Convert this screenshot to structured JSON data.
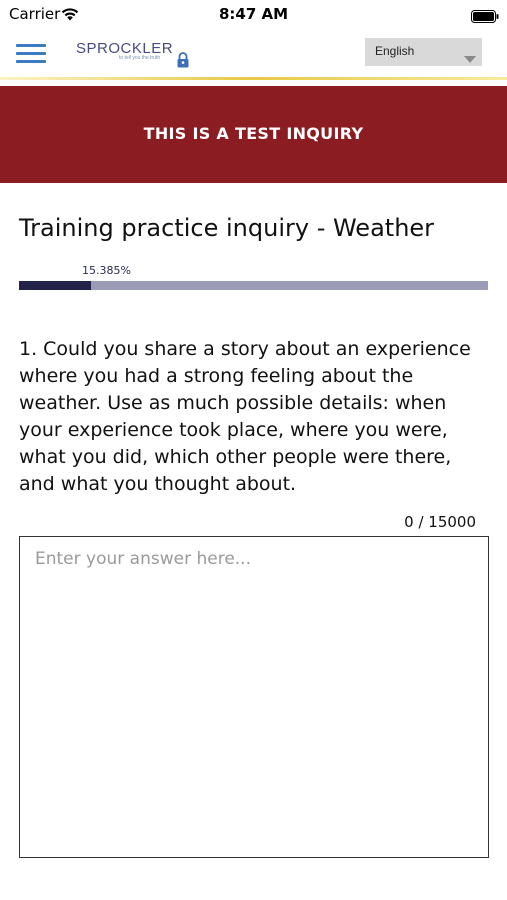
{
  "status_bar": {
    "carrier": "Carrier",
    "time": "8:47 AM",
    "wifi_icon": "wifi-icon",
    "battery_icon": "battery-icon"
  },
  "header": {
    "menu_icon": "hamburger-menu-icon",
    "logo_text": "SPROCKLER",
    "logo_tagline": "to tell you the truth",
    "lock_icon": "lock-icon",
    "language": {
      "selected": "English",
      "caret_icon": "chevron-down-icon"
    },
    "accent_line_color": "#e8c845"
  },
  "banner": {
    "text": "THIS IS A TEST INQUIRY",
    "color": "#8b1c22"
  },
  "inquiry": {
    "title": "Training practice inquiry - Weather",
    "progress": {
      "label": "15.385%",
      "value": 0.15385,
      "fill_color": "#23234a",
      "track_color": "#9b9bb6"
    },
    "question": "1. Could you share a story about an experience where you had a strong feeling about the weather. Use as much possible details: when your experience took place, where you were, what you did, which other people were there, and what you thought about.",
    "char_count": "0 / 15000",
    "answer": {
      "value": "",
      "placeholder": "Enter your answer here..."
    }
  }
}
